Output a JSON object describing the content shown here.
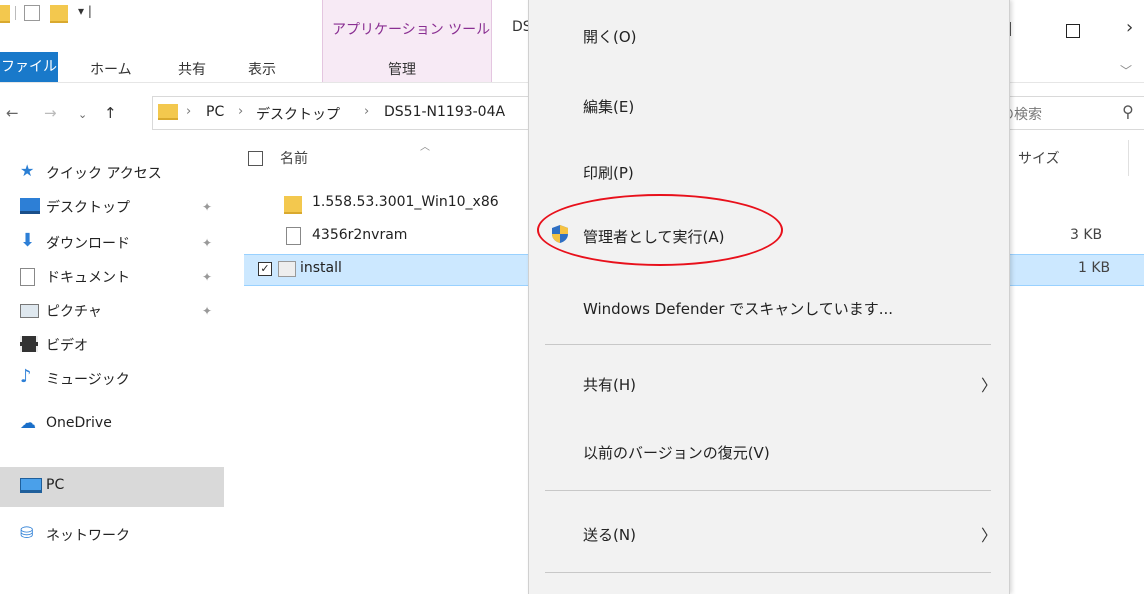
{
  "titlebar": {
    "context_tools_label": "アプリケーション ツール",
    "title_fragment": "DS",
    "drop_glyph": "▾ |"
  },
  "ribbon": {
    "tabs": [
      "ファイル",
      "ホーム",
      "共有",
      "表示",
      "管理"
    ]
  },
  "address": {
    "breadcrumb": [
      "PC",
      "デスクトップ",
      "DS51-N1193-04A"
    ],
    "search_placeholder": "の検索"
  },
  "nav_pane": {
    "items": [
      {
        "label": "クイック アクセス",
        "icon": "star-icon",
        "color": "#2b7fd4"
      },
      {
        "label": "デスクトップ",
        "icon": "desktop-icon",
        "pinned": true
      },
      {
        "label": "ダウンロード",
        "icon": "download-icon",
        "pinned": true
      },
      {
        "label": "ドキュメント",
        "icon": "document-icon",
        "pinned": true
      },
      {
        "label": "ピクチャ",
        "icon": "picture-icon",
        "pinned": true
      },
      {
        "label": "ビデオ",
        "icon": "video-icon"
      },
      {
        "label": "ミュージック",
        "icon": "music-icon"
      },
      {
        "label": "OneDrive",
        "icon": "cloud-icon"
      },
      {
        "label": "PC",
        "icon": "pc-icon",
        "selected": true
      },
      {
        "label": "ネットワーク",
        "icon": "network-icon"
      }
    ]
  },
  "file_list": {
    "headers": {
      "name": "名前",
      "size": "サイズ"
    },
    "rows": [
      {
        "name": "1.558.53.3001_Win10_x86",
        "type": "folder",
        "size": ""
      },
      {
        "name": "4356r2nvram",
        "type": "file",
        "size": "3 KB"
      },
      {
        "name": "install",
        "type": "script",
        "size": "1 KB",
        "selected": true
      }
    ]
  },
  "context_menu": {
    "items": [
      {
        "label": "開く(O)"
      },
      {
        "label": "編集(E)"
      },
      {
        "label": "印刷(P)"
      },
      {
        "label": "管理者として実行(A)",
        "icon": "shield-icon",
        "highlighted": true
      },
      {
        "label": "Windows Defender でスキャンしています..."
      },
      {
        "label": "共有(H)",
        "submenu": true
      },
      {
        "label": "以前のバージョンの復元(V)"
      },
      {
        "label": "送る(N)",
        "submenu": true
      }
    ],
    "highlight_color": "#e8101b"
  }
}
